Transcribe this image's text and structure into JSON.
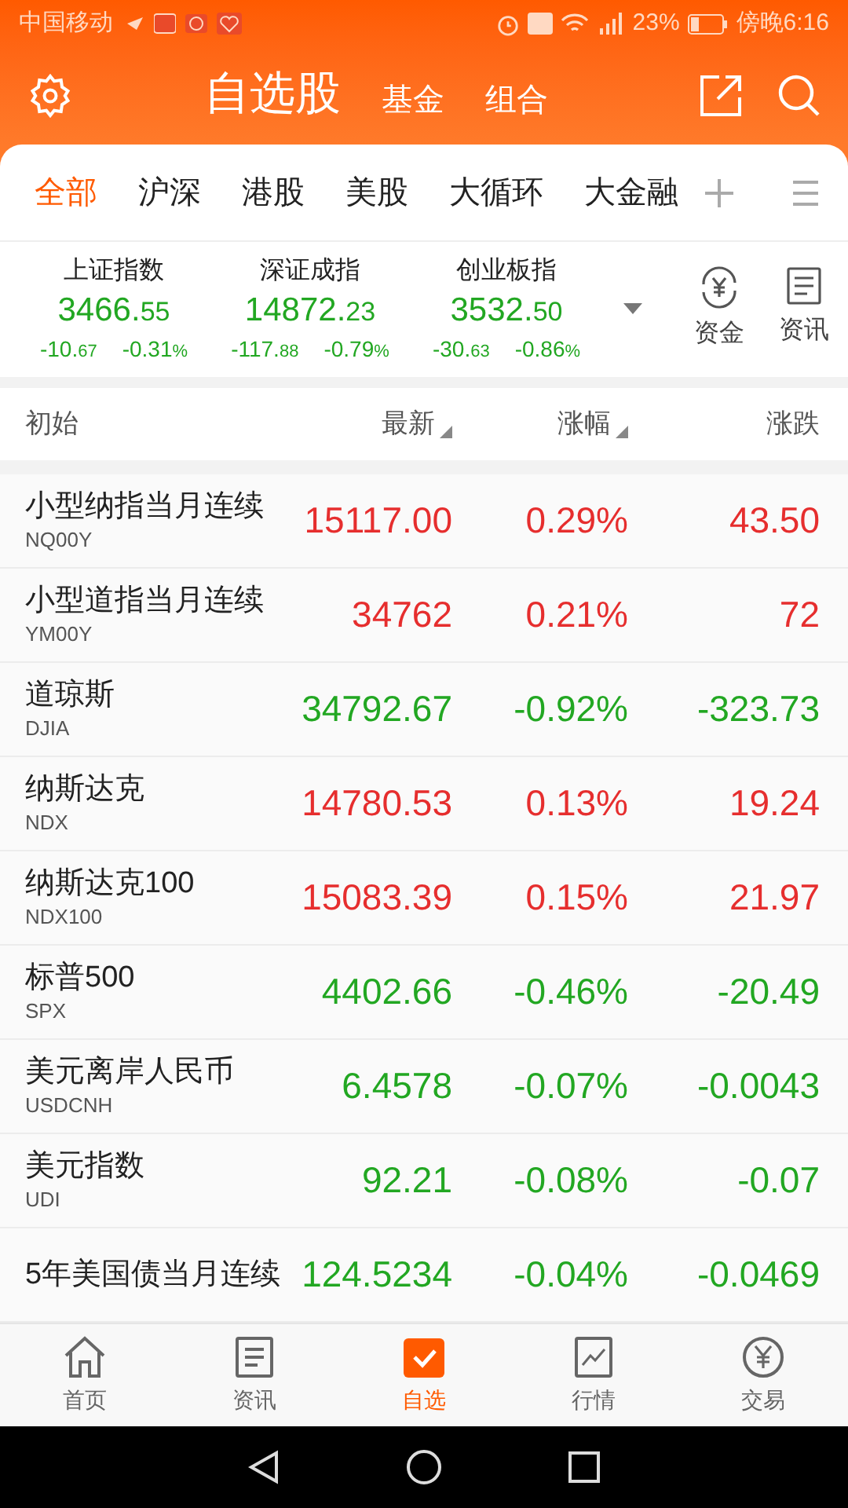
{
  "status_bar": {
    "carrier": "中国移动",
    "battery": "23%",
    "time": "傍晚6:16"
  },
  "header": {
    "title": "自选股",
    "links": [
      {
        "label": "基金"
      },
      {
        "label": "组合"
      }
    ]
  },
  "tabs": [
    {
      "label": "全部",
      "selected": true
    },
    {
      "label": "沪深",
      "selected": false
    },
    {
      "label": "港股",
      "selected": false
    },
    {
      "label": "美股",
      "selected": false
    },
    {
      "label": "大循环",
      "selected": false
    },
    {
      "label": "大金融",
      "selected": false
    }
  ],
  "indices": [
    {
      "name": "上证指数",
      "value": "3466.55",
      "change": "-10.67",
      "percent": "-0.31%",
      "color": "#22a722"
    },
    {
      "name": "深证成指",
      "value": "14872.23",
      "change": "-117.88",
      "percent": "-0.79%",
      "color": "#22a722"
    },
    {
      "name": "创业板指",
      "value": "3532.50",
      "change": "-30.63",
      "percent": "-0.86%",
      "color": "#22a722"
    }
  ],
  "quick_links": [
    {
      "label": "资金",
      "kind": "fund"
    },
    {
      "label": "资讯",
      "kind": "news"
    }
  ],
  "table": {
    "columns": [
      {
        "label": "初始",
        "sortable": false
      },
      {
        "label": "最新",
        "sortable": true
      },
      {
        "label": "涨幅",
        "sortable": true
      },
      {
        "label": "涨跌",
        "sortable": false
      }
    ],
    "rows": [
      {
        "name": "小型纳指当月连续",
        "code": "NQ00Y",
        "price": "15117.00",
        "percent": "0.29%",
        "change": "43.50",
        "color": "#e62e2e"
      },
      {
        "name": "小型道指当月连续",
        "code": "YM00Y",
        "price": "34762",
        "percent": "0.21%",
        "change": "72",
        "color": "#e62e2e"
      },
      {
        "name": "道琼斯",
        "code": "DJIA",
        "price": "34792.67",
        "percent": "-0.92%",
        "change": "-323.73",
        "color": "#22a722"
      },
      {
        "name": "纳斯达克",
        "code": "NDX",
        "price": "14780.53",
        "percent": "0.13%",
        "change": "19.24",
        "color": "#e62e2e"
      },
      {
        "name": "纳斯达克100",
        "code": "NDX100",
        "price": "15083.39",
        "percent": "0.15%",
        "change": "21.97",
        "color": "#e62e2e"
      },
      {
        "name": "标普500",
        "code": "SPX",
        "price": "4402.66",
        "percent": "-0.46%",
        "change": "-20.49",
        "color": "#22a722"
      },
      {
        "name": "美元离岸人民币",
        "code": "USDCNH",
        "price": "6.4578",
        "percent": "-0.07%",
        "change": "-0.0043",
        "color": "#22a722"
      },
      {
        "name": "美元指数",
        "code": "UDI",
        "price": "92.21",
        "percent": "-0.08%",
        "change": "-0.07",
        "color": "#22a722"
      },
      {
        "name": "5年美国债当月连续",
        "price": "124.5234",
        "percent": "-0.04%",
        "change": "-0.0469",
        "color": "#22a722"
      }
    ]
  },
  "bottom_nav": [
    {
      "label": "首页",
      "kind": "home",
      "selected": false
    },
    {
      "label": "资讯",
      "kind": "news",
      "selected": false
    },
    {
      "label": "自选",
      "kind": "watch",
      "selected": true
    },
    {
      "label": "行情",
      "kind": "chart",
      "selected": false
    },
    {
      "label": "交易",
      "kind": "trade",
      "selected": false
    }
  ]
}
